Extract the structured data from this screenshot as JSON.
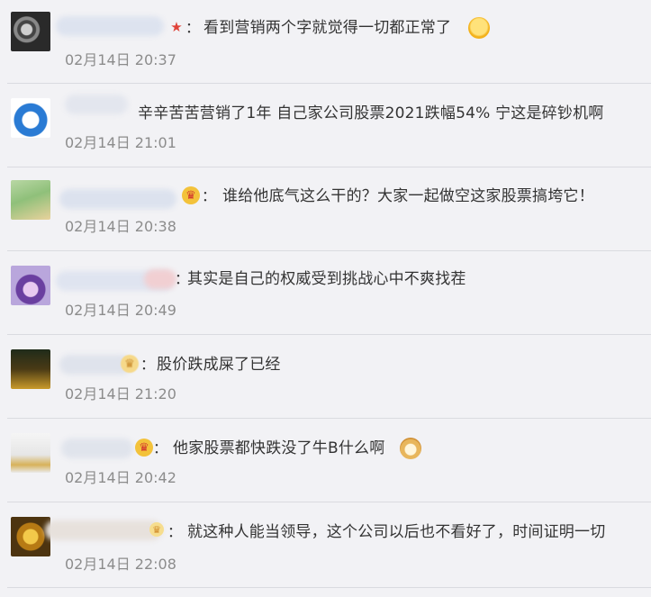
{
  "comments": [
    {
      "colon": "：",
      "text": "看到营销两个字就觉得一切都正常了",
      "time": "02月14日 20:37",
      "trailing_icon": "smile-emoji-icon"
    },
    {
      "colon": "",
      "text": "辛辛苦苦营销了1年 自己家公司股票2021跌幅54% 宁这是碎钞机啊",
      "time": "02月14日 21:01",
      "trailing_icon": ""
    },
    {
      "colon": "：",
      "text": "谁给他底气这么干的？大家一起做空这家股票搞垮它！",
      "time": "02月14日 20:38",
      "trailing_icon": ""
    },
    {
      "colon": "：",
      "text": "其实是自己的权威受到挑战心中不爽找茬",
      "time": "02月14日 20:49",
      "trailing_icon": ""
    },
    {
      "colon": "：",
      "text": "股价跌成屎了已经",
      "time": "02月14日 21:20",
      "trailing_icon": ""
    },
    {
      "colon": "：",
      "text": "他家股票都快跌没了牛B什么啊",
      "time": "02月14日 20:42",
      "trailing_icon": "doge-emoji-icon"
    },
    {
      "colon": "：",
      "text": "就这种人能当领导，这个公司以后也不看好了，时间证明一切",
      "time": "02月14日 22:08",
      "trailing_icon": ""
    }
  ],
  "colors": {
    "background": "#f2f2f5",
    "text": "#333333",
    "time": "#8c8c8c",
    "divider": "#dadbe0"
  }
}
